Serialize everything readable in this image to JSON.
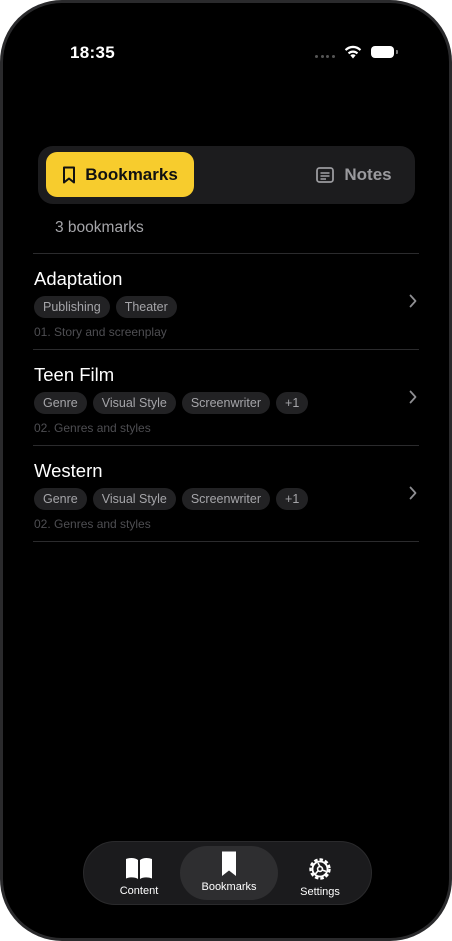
{
  "status_bar": {
    "time": "18:35"
  },
  "segment": {
    "bookmarks_label": "Bookmarks",
    "notes_label": "Notes"
  },
  "bookmark_count": "3 bookmarks",
  "bookmarks": [
    {
      "title": "Adaptation",
      "tags": [
        "Publishing",
        "Theater"
      ],
      "subtitle": "01. Story and screenplay"
    },
    {
      "title": "Teen Film",
      "tags": [
        "Genre",
        "Visual Style",
        "Screenwriter",
        "+1"
      ],
      "subtitle": "02. Genres and styles"
    },
    {
      "title": "Western",
      "tags": [
        "Genre",
        "Visual Style",
        "Screenwriter",
        "+1"
      ],
      "subtitle": "02. Genres and styles"
    }
  ],
  "tabbar": {
    "content_label": "Content",
    "bookmarks_label": "Bookmarks",
    "settings_label": "Settings"
  },
  "colors": {
    "accent": "#f7cc2d",
    "background": "#000000",
    "card": "#1c1c1e"
  },
  "icons": {
    "segment_bookmarks": "bookmark-icon",
    "segment_notes": "notes-icon",
    "row": "chevron-right-icon",
    "tab_content": "book-icon",
    "tab_bookmarks": "bookmark-fill-icon",
    "tab_settings": "gear-icon"
  }
}
